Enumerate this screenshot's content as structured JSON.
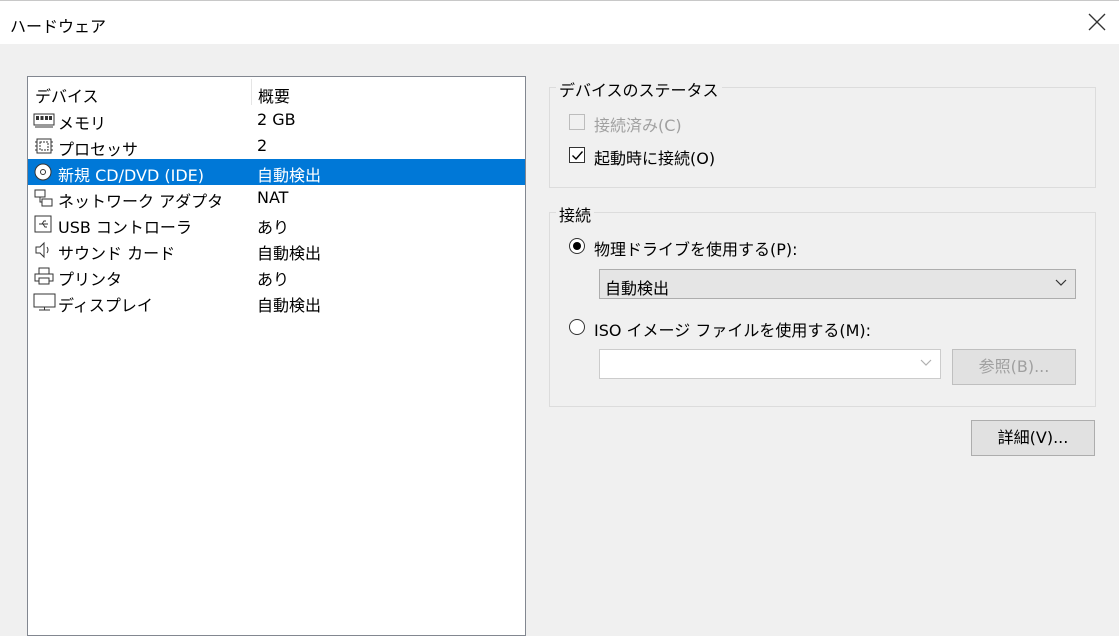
{
  "window": {
    "title": "ハードウェア",
    "close_glyph": "×"
  },
  "device_list": {
    "headers": {
      "device": "デバイス",
      "summary": "概要"
    },
    "items": [
      {
        "name": "メモリ",
        "summary": "2 GB",
        "icon": "memory-icon"
      },
      {
        "name": "プロセッサ",
        "summary": "2",
        "icon": "processor-icon"
      },
      {
        "name": "新規 CD/DVD (IDE)",
        "summary": "自動検出",
        "icon": "cd-dvd-icon",
        "selected": true
      },
      {
        "name": "ネットワーク アダプタ",
        "summary": "NAT",
        "icon": "network-adapter-icon"
      },
      {
        "name": "USB コントローラ",
        "summary": "あり",
        "icon": "usb-icon"
      },
      {
        "name": "サウンド カード",
        "summary": "自動検出",
        "icon": "speaker-icon"
      },
      {
        "name": "プリンタ",
        "summary": "あり",
        "icon": "printer-icon"
      },
      {
        "name": "ディスプレイ",
        "summary": "自動検出",
        "icon": "display-icon"
      }
    ]
  },
  "device_status": {
    "title": "デバイスのステータス",
    "connected": {
      "label": "接続済み(C)",
      "checked": false,
      "disabled": true
    },
    "connect_at_power_on": {
      "label": "起動時に接続(O)",
      "checked": true
    }
  },
  "connection": {
    "title": "接続",
    "physical_drive": {
      "label": "物理ドライブを使用する(P):",
      "selected": true,
      "value": "自動検出"
    },
    "iso_image": {
      "label": "ISO イメージ ファイルを使用する(M):",
      "selected": false,
      "value": ""
    },
    "browse_label": "参照(B)..."
  },
  "advanced_label": "詳細(V)...",
  "colors": {
    "selection": "#0078d7",
    "background": "#f0f0f0",
    "disabled_text": "#a0a0a0"
  }
}
